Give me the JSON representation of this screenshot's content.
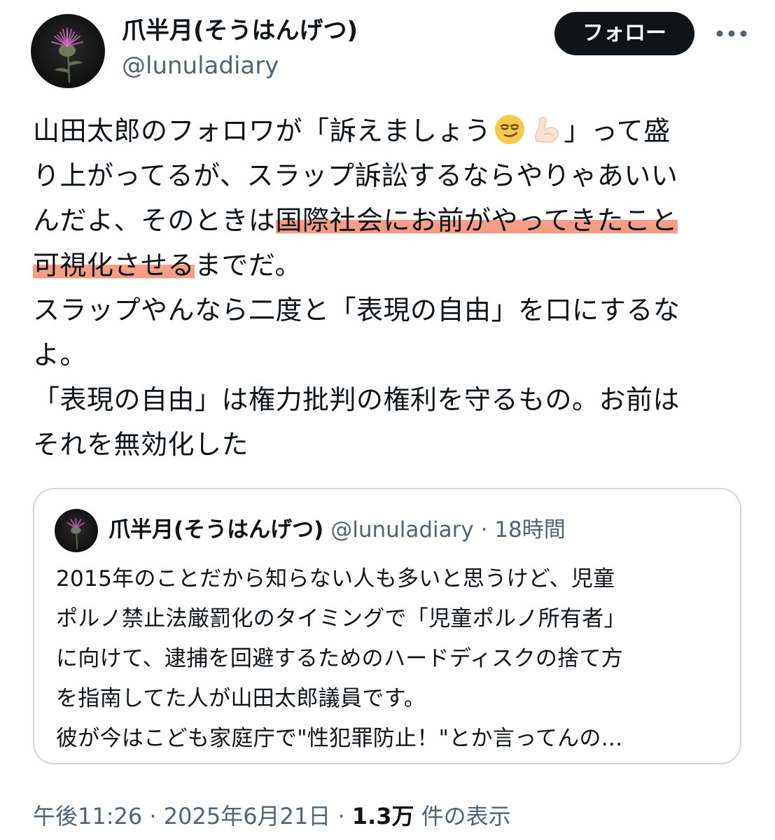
{
  "author": {
    "display_name": "爪半月(そうはんげつ)",
    "handle": "@lunuladiary"
  },
  "follow_label": "フォロー",
  "more_icon": "more-horizontal-icon",
  "tweet": {
    "line1_a": "山田太郎のフォロワが「訴えましょう",
    "line1_b": "」って盛",
    "emojis": [
      "smirking-face-emoji",
      "flexed-biceps-emoji"
    ],
    "line2": "り上がってるが、スラップ訴訟するならやりゃあいい",
    "line3_a": "んだよ、そのときは",
    "line3_hl": "国際社会にお前がやってきたこと",
    "line4_hl": "可視化させる",
    "line4_b": "までだ。",
    "line5": "スラップやんなら二度と「表現の自由」を口にするな",
    "line6": "よ。",
    "line7": "「表現の自由」は権力批判の権利を守るもの。お前は",
    "line8": "それを無効化した",
    "highlight_color": "#f39a83"
  },
  "quote": {
    "display_name": "爪半月(そうはんげつ)",
    "handle": "@lunuladiary",
    "separator": "·",
    "time": "18時間",
    "lines": [
      "2015年のことだから知らない人も多いと思うけど、児童",
      "ポルノ禁止法厳罰化のタイミングで「児童ポルノ所有者」",
      "に向けて、逮捕を回避するためのハードディスクの捨て方",
      "を指南してた人が山田太郎議員です。",
      "彼が今はこども家庭庁で\"性犯罪防止！\"とか言ってんの..."
    ]
  },
  "meta": {
    "time": "午後11:26",
    "sep1": "·",
    "date": "2025年6月21日",
    "sep2": "·",
    "views_count": "1.3万",
    "views_label": "件の表示"
  }
}
